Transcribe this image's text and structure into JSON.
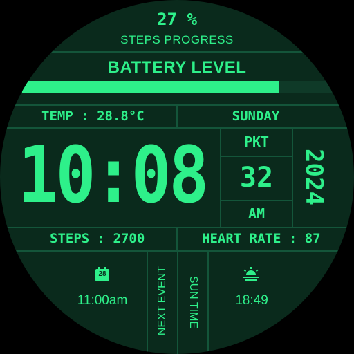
{
  "steps_progress": {
    "value": "27 %",
    "label": "STEPS PROGRESS"
  },
  "battery": {
    "label": "BATTERY LEVEL",
    "level": 0.83
  },
  "temp": {
    "label": "TEMP : 28.8°C"
  },
  "day": {
    "label": "SUNDAY"
  },
  "time": {
    "value": "10:08",
    "timezone": "PKT",
    "seconds": "32",
    "ampm": "AM",
    "year": "2024"
  },
  "steps": {
    "label": "STEPS : 2700"
  },
  "heart_rate": {
    "label": "HEART RATE : 87"
  },
  "next_event": {
    "icon": "calendar-icon",
    "date": "28",
    "time": "11:00am",
    "label": "NEXT EVENT"
  },
  "sun_time": {
    "icon": "sunset-icon",
    "time": "18:49",
    "label": "SUN TIME"
  },
  "colors": {
    "background": "#0a2a1c",
    "accent": "#2ef08a",
    "lines": "#14553a",
    "track": "#0f3a28"
  }
}
